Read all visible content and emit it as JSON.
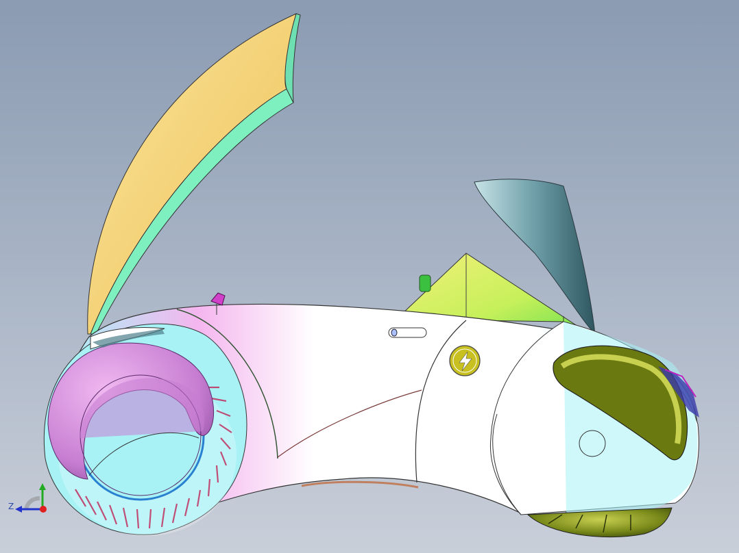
{
  "viewport": {
    "background_top": "#8b9bb2",
    "background_bottom": "#c9cfd9"
  },
  "triad": {
    "z_label": "Z",
    "axis_colors": {
      "x": "#e02020",
      "y": "#22aa22",
      "z": "#2233cc"
    }
  },
  "model": {
    "body_color": "#ffffff",
    "accent_pink": "#f0a8e8",
    "accent_cyan": "#a8f2f6",
    "canopy_front_color": "#f5d37a",
    "canopy_side_color": "#7ef0c0",
    "rear_panel_color": "#4e7f8a",
    "wedge_color": "#c8f060",
    "wheel_rim_color": "#cc80d8",
    "rear_wheel_color": "#6a7a14",
    "charging_badge_color": "#c8c020"
  }
}
